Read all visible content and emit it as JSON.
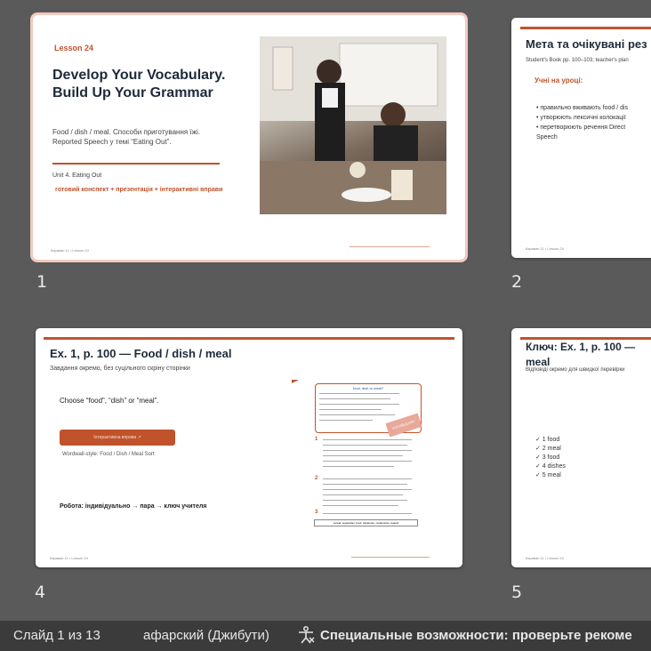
{
  "slides": [
    {
      "number": "1",
      "lesson": "Lesson 24",
      "title_line1": "Develop Your Vocabulary.",
      "title_line2": "Build Up Your Grammar",
      "subtitle_line1": "Food / dish / meal. Способи приготування їжі.",
      "subtitle_line2": "Reported Speech у темі “Eating Out”.",
      "unit": "Unit 4. Eating Out",
      "extras": "готовий конспект + презентація + інтерактивні вправи",
      "footer": "Караван 11 • Lesson 24"
    },
    {
      "number": "2",
      "title": "Мета та очікувані рез",
      "subtitle": "Student's Book pp. 100–103; teacher's plan",
      "heading": "Учні на уроці:",
      "items": [
        "• правильно вживають food / dis",
        "• утворюють лексичні колокації",
        "• перетворюють речення Direct",
        "Speech"
      ],
      "footer": "Караван 11 • Lesson 24"
    },
    {
      "number": "4",
      "title": "Ex. 1, p. 100 — Food / dish / meal",
      "subtitle": "Завдання окремо, без суцільного скріну сторінки",
      "prompt": "Choose “food”, “dish” or “meal”.",
      "button": "Інтерактивна вправа ↗",
      "wordwall": "Wordwall-style: Food / Dish / Meal Sort",
      "work": "Робота: індивідуально → пара → ключ учителя",
      "book_title": "food, dish or meal?",
      "book_tag": "VOCABULARY LENS",
      "book_numbers": [
        "1",
        "2",
        "3"
      ],
      "book_footer": "cereal, vegetarian, food, Japanese, restaurants, tequeli",
      "footer": "Караван 11 • Lesson 24"
    },
    {
      "number": "5",
      "title": "Ключ: Ex. 1, p. 100 — meal",
      "subtitle": "Відповіді окремо для швидкої перевірки",
      "keys": [
        "✓ 1 food",
        "✓ 2 meal",
        "✓ 3 food",
        "✓ 4 dishes",
        "✓ 5 meal"
      ],
      "footer": "Караван 11 • Lesson 24"
    }
  ],
  "status": {
    "slide_counter": "Слайд 1 из 13",
    "language": "афарский (Джибути)",
    "accessibility": "Специальные возможности: проверьте рекоме"
  },
  "colors": {
    "accent": "#c0532b",
    "background": "#5a5a5a",
    "statusbar": "#3b3b3b"
  }
}
